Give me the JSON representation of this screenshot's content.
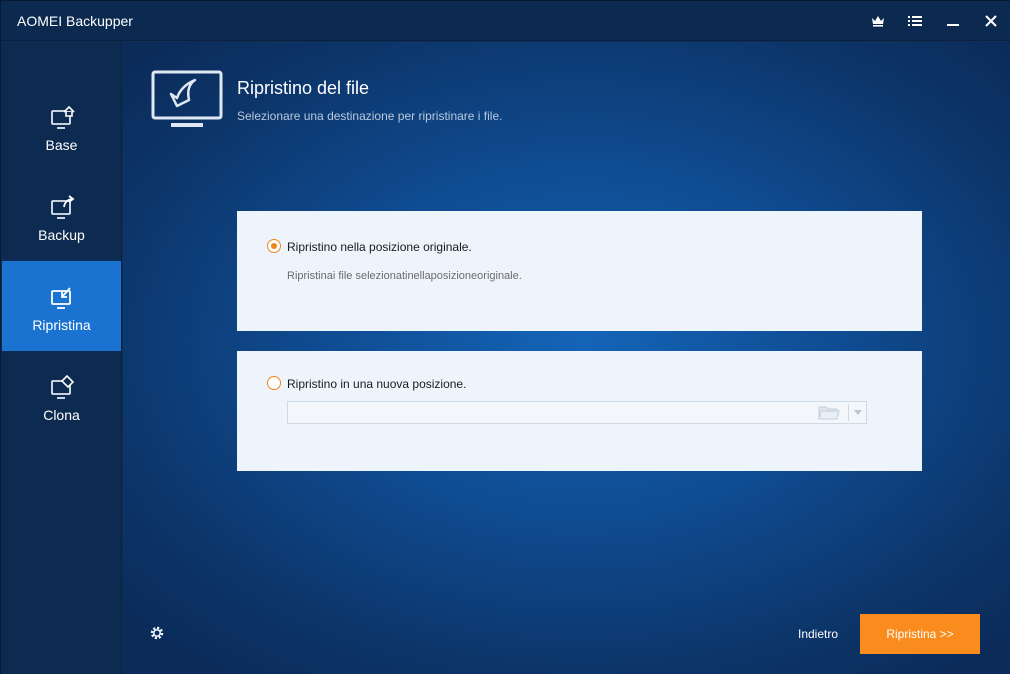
{
  "app": {
    "title": "AOMEI Backupper"
  },
  "titlebar": {
    "icons": [
      "crown-icon",
      "menu-icon",
      "minimize-icon",
      "close-icon"
    ]
  },
  "sidebar": {
    "items": [
      {
        "label": "Base",
        "icon": "monitor-home-icon",
        "active": false
      },
      {
        "label": "Backup",
        "icon": "monitor-backup-icon",
        "active": false
      },
      {
        "label": "Ripristina",
        "icon": "monitor-restore-icon",
        "active": true
      },
      {
        "label": "Clona",
        "icon": "monitor-clone-icon",
        "active": false
      }
    ],
    "settings_icon": "gear-icon"
  },
  "header": {
    "title": "Ripristino del file",
    "subtitle": "Selezionare una destinazione per ripristinare i file."
  },
  "options": {
    "original": {
      "label": "Ripristino nella posizione originale.",
      "description": "Ripristinai file selezionatinellaposizioneoriginale.",
      "selected": true
    },
    "new_location": {
      "label": "Ripristino in una nuova posizione.",
      "selected": false,
      "path_value": "",
      "path_placeholder": ""
    }
  },
  "footer": {
    "back_label": "Indietro",
    "primary_label": "Ripristina >>"
  },
  "colors": {
    "accent": "#f98c1c",
    "active_nav": "#1a73d0",
    "background": "#0e2e55"
  }
}
